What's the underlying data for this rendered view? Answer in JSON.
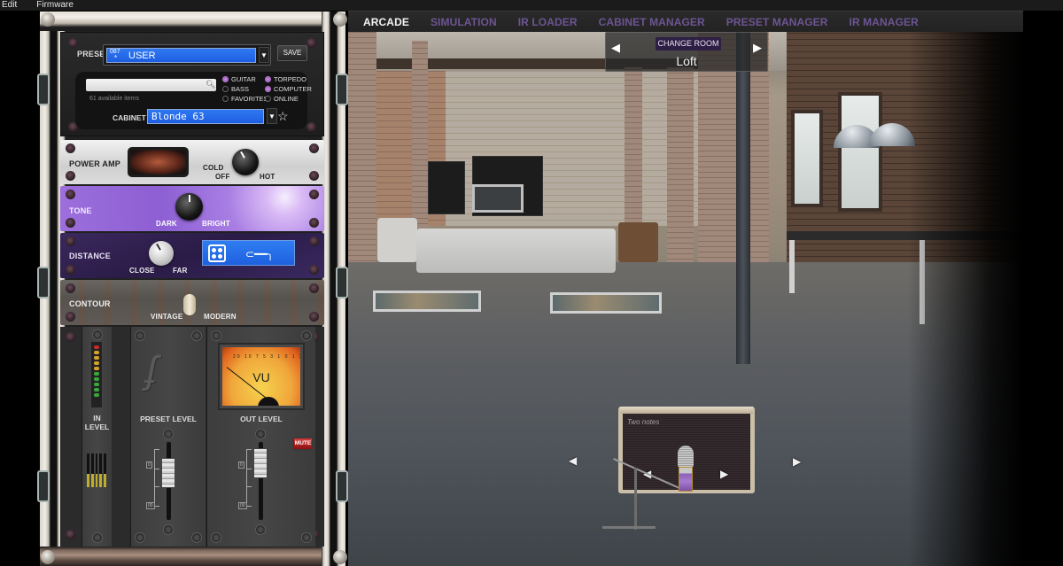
{
  "menu": {
    "items": [
      "Edit",
      "Firmware"
    ]
  },
  "nav": {
    "tabs": [
      {
        "label": "ARCADE",
        "active": true
      },
      {
        "label": "SIMULATION",
        "active": false
      },
      {
        "label": "IR LOADER",
        "active": false
      },
      {
        "label": "CABINET MANAGER",
        "active": false
      },
      {
        "label": "PRESET MANAGER",
        "active": false
      },
      {
        "label": "IR MANAGER",
        "active": false
      }
    ],
    "active_color": "#f3f3f3",
    "inactive_color": "#6d5593"
  },
  "room": {
    "change_label": "CHANGE ROOM",
    "name": "Loft",
    "prev_icon": "arrow-left-icon",
    "next_icon": "arrow-right-icon"
  },
  "rack": {
    "preset": {
      "label": "PRESET",
      "number": "087",
      "modified_mark": "*",
      "name": "USER",
      "save_label": "SAVE"
    },
    "browser": {
      "search_value": "",
      "search_placeholder": "",
      "available_text": "61 available items",
      "type_filters": [
        {
          "label": "GUITAR",
          "selected": true
        },
        {
          "label": "BASS",
          "selected": false
        },
        {
          "label": "FAVORITES",
          "selected": false
        }
      ],
      "source_filters": [
        {
          "label": "TORPEDO",
          "selected": true
        },
        {
          "label": "COMPUTER",
          "selected": true
        },
        {
          "label": "ONLINE",
          "selected": false
        }
      ],
      "cabinet_label": "CABINET",
      "cabinet_value": "Blonde 63"
    },
    "power_amp": {
      "label": "POWER AMP",
      "off_label": "OFF",
      "cold_label": "COLD",
      "hot_label": "HOT"
    },
    "tone": {
      "label": "TONE",
      "min_label": "DARK",
      "max_label": "BRIGHT"
    },
    "distance": {
      "label": "DISTANCE",
      "min_label": "CLOSE",
      "max_label": "FAR"
    },
    "contour": {
      "label": "CONTOUR",
      "left_label": "VINTAGE",
      "right_label": "MODERN"
    },
    "meters": {
      "in_level_label_1": "IN",
      "in_level_label_2": "LEVEL",
      "preset_level_label": "PRESET LEVEL",
      "out_level_label": "OUT LEVEL",
      "vu_label": "VU",
      "vu_scale": "20 10 7 5 3 1 0 1 2 3",
      "mute_label": "MUTE",
      "fader_top_mark": "0",
      "fader_bottom_mark": "00"
    }
  },
  "stage": {
    "cab_logo": "Two notes",
    "arrows": [
      "arrow-left-icon",
      "arrow-right-icon"
    ]
  }
}
